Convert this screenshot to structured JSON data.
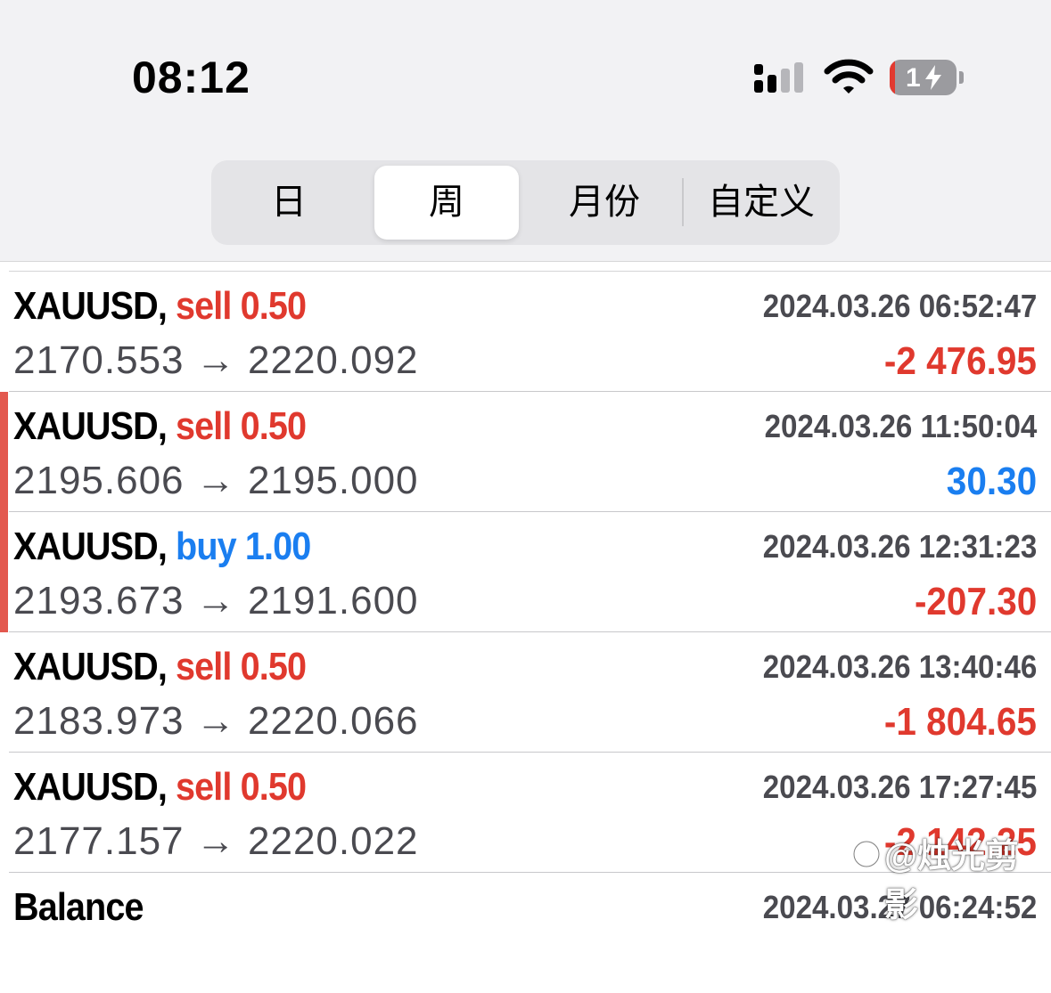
{
  "status_bar": {
    "time": "08:12",
    "battery_level": "1",
    "icons": [
      "signal-icon",
      "wifi-icon",
      "battery-charging-icon"
    ]
  },
  "tabs": [
    {
      "label": "日",
      "active": false
    },
    {
      "label": "周",
      "active": true
    },
    {
      "label": "月份",
      "active": false
    },
    {
      "label": "自定义",
      "active": false
    }
  ],
  "colors": {
    "sell": "#e0392e",
    "buy": "#1a7ef0",
    "loss": "#e0392e",
    "profit": "#1a7ef0",
    "highlight_bar": "#e3584e"
  },
  "trades": [
    {
      "symbol": "XAUUSD,",
      "side": "sell",
      "volume": "0.50",
      "time": "2024.03.26 06:52:47",
      "open": "2170.553",
      "arrow": "→",
      "close": "2220.092",
      "profit": "-2 476.95",
      "profit_type": "neg",
      "highlighted": false
    },
    {
      "symbol": "XAUUSD,",
      "side": "sell",
      "volume": "0.50",
      "time": "2024.03.26 11:50:04",
      "open": "2195.606",
      "arrow": "→",
      "close": "2195.000",
      "profit": "30.30",
      "profit_type": "pos",
      "highlighted": true
    },
    {
      "symbol": "XAUUSD,",
      "side": "buy",
      "volume": "1.00",
      "time": "2024.03.26 12:31:23",
      "open": "2193.673",
      "arrow": "→",
      "close": "2191.600",
      "profit": "-207.30",
      "profit_type": "neg",
      "highlighted": true
    },
    {
      "symbol": "XAUUSD,",
      "side": "sell",
      "volume": "0.50",
      "time": "2024.03.26 13:40:46",
      "open": "2183.973",
      "arrow": "→",
      "close": "2220.066",
      "profit": "-1 804.65",
      "profit_type": "neg",
      "highlighted": false
    },
    {
      "symbol": "XAUUSD,",
      "side": "sell",
      "volume": "0.50",
      "time": "2024.03.26 17:27:45",
      "open": "2177.157",
      "arrow": "→",
      "close": "2220.022",
      "profit": "-2 142.25",
      "profit_type": "neg",
      "highlighted": false
    },
    {
      "symbol": "Balance",
      "side": "",
      "volume": "",
      "time": "2024.03.27 06:24:52",
      "open": "",
      "arrow": "",
      "close": "",
      "profit": "",
      "profit_type": "",
      "highlighted": false
    }
  ],
  "watermark": "@烛光剪影"
}
